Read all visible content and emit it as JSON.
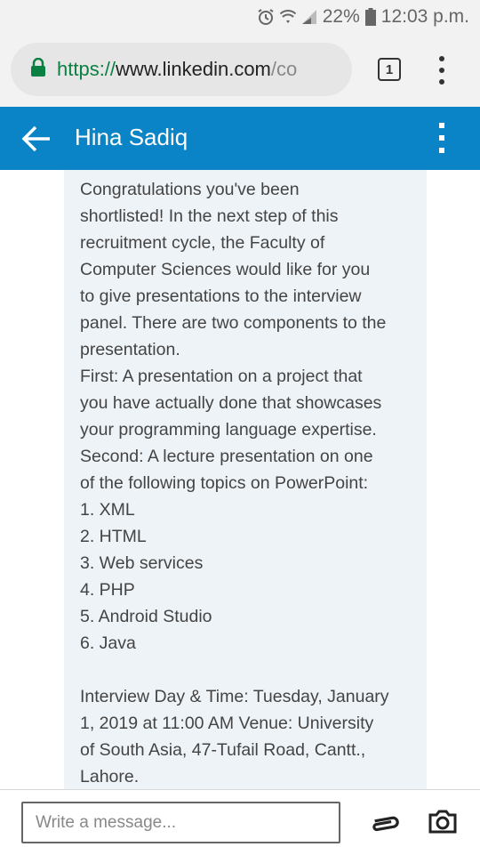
{
  "status_bar": {
    "battery": "22%",
    "time": "12:03 p.m.",
    "icons": [
      "alarm-icon",
      "wifi-icon",
      "signal-icon",
      "battery-icon"
    ]
  },
  "browser": {
    "url_scheme": "https://",
    "url_host": "www.linkedin.com",
    "url_rest": "/co",
    "tab_count": "1"
  },
  "header": {
    "contact_name": "Hina Sadiq"
  },
  "message": {
    "intro_lines": [
      "Congratulations you've been",
      "shortlisted! In the next step of this",
      "recruitment cycle, the Faculty of",
      "Computer Sciences would like for you",
      "to give presentations to the interview",
      "panel. There are two components to the",
      "presentation.",
      "First: A presentation on a project that",
      "you have actually done that showcases",
      "your programming language expertise.",
      "Second: A lecture presentation on one",
      "of the following topics on PowerPoint:"
    ],
    "topics": [
      "1. XML",
      "2. HTML",
      "3. Web services",
      "4. PHP",
      "5. Android Studio",
      "6. Java"
    ],
    "details_lines": [
      "Interview Day & Time: Tuesday, January",
      "1, 2019 at 11:00 AM Venue: University",
      "of South Asia, 47-Tufail Road, Cantt.,",
      "Lahore."
    ]
  },
  "composer": {
    "placeholder": "Write a message..."
  },
  "colors": {
    "header_bg": "#0a84c6",
    "bubble_bg": "#eef3f7",
    "lock_green": "#0b8043"
  }
}
